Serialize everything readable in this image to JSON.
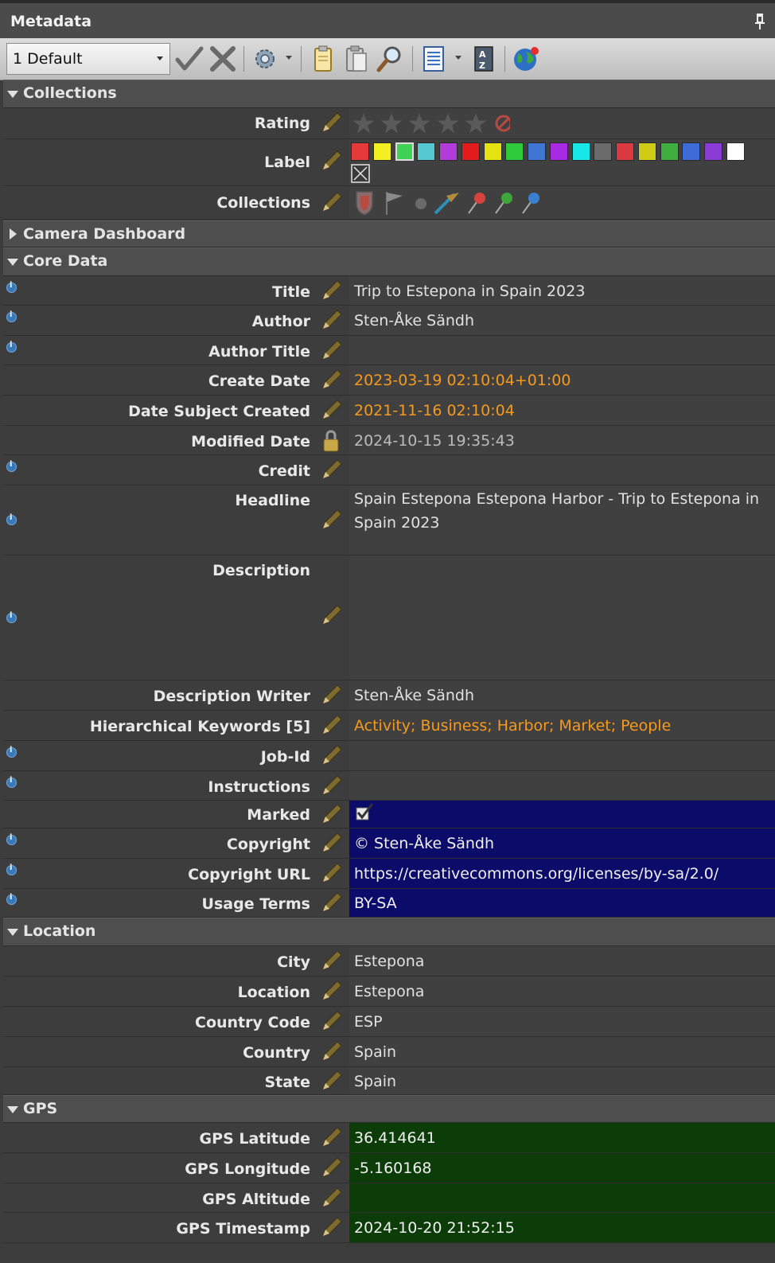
{
  "panel": {
    "title": "Metadata"
  },
  "toolbar": {
    "preset": "1 Default"
  },
  "sections": {
    "collections": "Collections",
    "camera_dashboard": "Camera Dashboard",
    "core_data": "Core Data",
    "location": "Location",
    "gps": "GPS"
  },
  "collections_rows": {
    "rating_label": "Rating",
    "label_label": "Label",
    "collections_label": "Collections",
    "label_colors": [
      "#e53a3a",
      "#f3f024",
      "#3fd257",
      "#55c9d2",
      "#b23bda",
      "#e21b1b",
      "#e6e212",
      "#2fcb3c",
      "#3f76d1",
      "#a72ae2",
      "#19e6e6",
      "#6b6b6b",
      "#d9393f",
      "#cfcc18",
      "#3fae3f",
      "#3d6cd9",
      "#8a3bd6",
      "#ffffff"
    ],
    "rating_stars": 0
  },
  "core": {
    "title": {
      "label": "Title",
      "value": "Trip to Estepona in Spain 2023"
    },
    "author": {
      "label": "Author",
      "value": "Sten-Åke Sändh"
    },
    "author_title": {
      "label": "Author Title",
      "value": ""
    },
    "create_date": {
      "label": "Create Date",
      "value": "2023-03-19 02:10:04+01:00"
    },
    "date_subject": {
      "label": "Date Subject Created",
      "value": "2021-11-16 02:10:04"
    },
    "modified": {
      "label": "Modified Date",
      "value": "2024-10-15 19:35:43"
    },
    "credit": {
      "label": "Credit",
      "value": ""
    },
    "headline": {
      "label": "Headline",
      "line1": "Spain Estepona Estepona Harbor - Trip to Estepona in",
      "line2": "Spain 2023"
    },
    "description": {
      "label": "Description",
      "value": ""
    },
    "desc_writer": {
      "label": "Description Writer",
      "value": "Sten-Åke Sändh"
    },
    "keywords": {
      "label": "Hierarchical Keywords [5]",
      "value": "Activity; Business; Harbor; Market; People"
    },
    "job_id": {
      "label": "Job-Id",
      "value": ""
    },
    "instructions": {
      "label": "Instructions",
      "value": ""
    },
    "marked": {
      "label": "Marked",
      "checked": true
    },
    "copyright": {
      "label": "Copyright",
      "value": "© Sten-Åke Sändh"
    },
    "copyright_url": {
      "label": "Copyright URL",
      "value": "https://creativecommons.org/licenses/by-sa/2.0/"
    },
    "usage": {
      "label": "Usage Terms",
      "value": "BY-SA"
    }
  },
  "location": {
    "city": {
      "label": "City",
      "value": "Estepona"
    },
    "location": {
      "label": "Location",
      "value": "Estepona"
    },
    "country_code": {
      "label": "Country Code",
      "value": "ESP"
    },
    "country": {
      "label": "Country",
      "value": "Spain"
    },
    "state": {
      "label": "State",
      "value": "Spain"
    }
  },
  "gps": {
    "lat": {
      "label": "GPS Latitude",
      "value": "36.414641"
    },
    "lon": {
      "label": "GPS Longitude",
      "value": "-5.160168"
    },
    "alt": {
      "label": "GPS Altitude",
      "value": ""
    },
    "ts": {
      "label": "GPS Timestamp",
      "value": "2024-10-20 21:52:15"
    }
  }
}
